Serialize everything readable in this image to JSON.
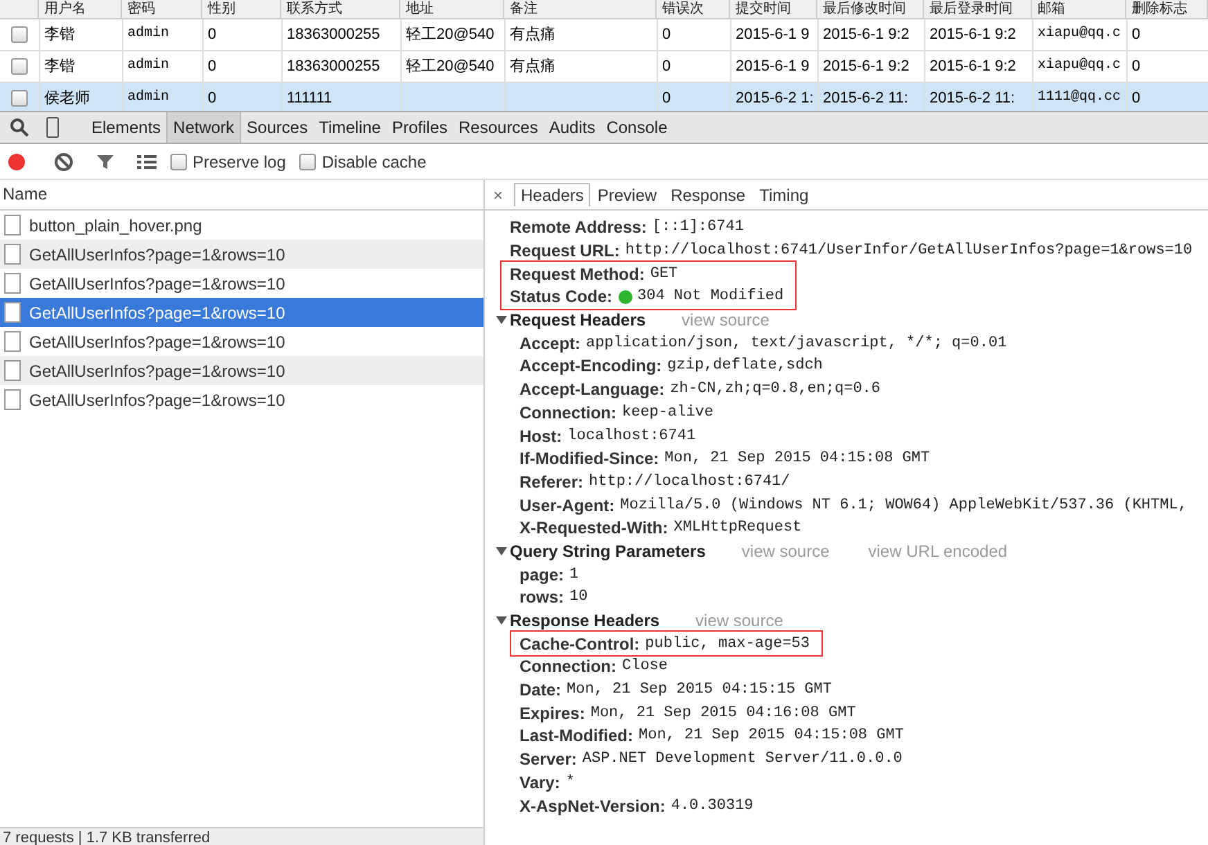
{
  "page_table": {
    "columns": [
      "用户名",
      "密码",
      "性别",
      "联系方式",
      "地址",
      "备注",
      "错误次",
      "提交时间",
      "最后修改时间",
      "最后登录时间",
      "邮箱",
      "删除标志"
    ],
    "rows": [
      {
        "checked": false,
        "selected": false,
        "cells": [
          "李锴",
          "admin",
          "0",
          "18363000255",
          "轻工20@540",
          "有点痛",
          "0",
          "2015-6-1 9",
          "2015-6-1 9:2",
          "2015-6-1 9:2",
          "xiapu@qq.c",
          "0"
        ]
      },
      {
        "checked": false,
        "selected": false,
        "cells": [
          "李锴",
          "admin",
          "0",
          "18363000255",
          "轻工20@540",
          "有点痛",
          "0",
          "2015-6-1 9",
          "2015-6-1 9:2",
          "2015-6-1 9:2",
          "xiapu@qq.c",
          "0"
        ]
      },
      {
        "checked": false,
        "selected": true,
        "cells": [
          "侯老师",
          "admin",
          "0",
          "111111",
          "",
          "",
          "0",
          "2015-6-2 1:",
          "2015-6-2 11:",
          "2015-6-2 11:",
          "1111@qq.cc",
          "0"
        ]
      }
    ]
  },
  "devtools": {
    "tabs": [
      {
        "label": "Elements",
        "selected": false
      },
      {
        "label": "Network",
        "selected": true
      },
      {
        "label": "Sources",
        "selected": false
      },
      {
        "label": "Timeline",
        "selected": false
      },
      {
        "label": "Profiles",
        "selected": false
      },
      {
        "label": "Resources",
        "selected": false
      },
      {
        "label": "Audits",
        "selected": false
      },
      {
        "label": "Console",
        "selected": false
      }
    ],
    "toolbar": {
      "recording": true,
      "checkboxes": [
        {
          "label": "Preserve log",
          "checked": false
        },
        {
          "label": "Disable cache",
          "checked": false
        }
      ]
    },
    "requests": {
      "column": "Name",
      "items": [
        {
          "name": "button_plain_hover.png",
          "selected": false
        },
        {
          "name": "GetAllUserInfos?page=1&rows=10",
          "selected": false
        },
        {
          "name": "GetAllUserInfos?page=1&rows=10",
          "selected": false
        },
        {
          "name": "GetAllUserInfos?page=1&rows=10",
          "selected": true
        },
        {
          "name": "GetAllUserInfos?page=1&rows=10",
          "selected": false
        },
        {
          "name": "GetAllUserInfos?page=1&rows=10",
          "selected": false
        },
        {
          "name": "GetAllUserInfos?page=1&rows=10",
          "selected": false
        }
      ]
    },
    "status_bar": "7 requests | 1.7 KB transferred",
    "detail": {
      "close": "×",
      "tabs": [
        {
          "label": "Headers",
          "selected": true
        },
        {
          "label": "Preview",
          "selected": false
        },
        {
          "label": "Response",
          "selected": false
        },
        {
          "label": "Timing",
          "selected": false
        }
      ],
      "general": [
        {
          "key": "Remote Address:",
          "value": "[::1]:6741",
          "highlighted": false,
          "kind": "text"
        },
        {
          "key": "Request URL:",
          "value": "http://localhost:6741/UserInfor/GetAllUserInfos?page=1&rows=10",
          "highlighted": false,
          "kind": "text"
        },
        {
          "key": "Request Method:",
          "value": "GET",
          "highlighted": true,
          "kind": "text"
        },
        {
          "key": "Status Code:",
          "value": "304 Not Modified",
          "highlighted": true,
          "kind": "status"
        }
      ],
      "sections": [
        {
          "title": "Request Headers",
          "expanded": true,
          "links": [
            "view source"
          ],
          "items": [
            {
              "key": "Accept:",
              "value": "application/json, text/javascript, */*; q=0.01",
              "highlighted": false
            },
            {
              "key": "Accept-Encoding:",
              "value": "gzip,deflate,sdch",
              "highlighted": false
            },
            {
              "key": "Accept-Language:",
              "value": "zh-CN,zh;q=0.8,en;q=0.6",
              "highlighted": false
            },
            {
              "key": "Connection:",
              "value": "keep-alive",
              "highlighted": false
            },
            {
              "key": "Host:",
              "value": "localhost:6741",
              "highlighted": false
            },
            {
              "key": "If-Modified-Since:",
              "value": "Mon, 21 Sep 2015 04:15:08 GMT",
              "highlighted": false
            },
            {
              "key": "Referer:",
              "value": "http://localhost:6741/",
              "highlighted": false
            },
            {
              "key": "User-Agent:",
              "value": "Mozilla/5.0 (Windows NT 6.1; WOW64) AppleWebKit/537.36 (KHTML,",
              "highlighted": false
            },
            {
              "key": "X-Requested-With:",
              "value": "XMLHttpRequest",
              "highlighted": false
            }
          ]
        },
        {
          "title": "Query String Parameters",
          "expanded": true,
          "links": [
            "view source",
            "view URL encoded"
          ],
          "items": [
            {
              "key": "page:",
              "value": "1",
              "highlighted": false
            },
            {
              "key": "rows:",
              "value": "10",
              "highlighted": false
            }
          ]
        },
        {
          "title": "Response Headers",
          "expanded": true,
          "links": [
            "view source"
          ],
          "items": [
            {
              "key": "Cache-Control:",
              "value": "public, max-age=53",
              "highlighted": true
            },
            {
              "key": "Connection:",
              "value": "Close",
              "highlighted": false
            },
            {
              "key": "Date:",
              "value": "Mon, 21 Sep 2015 04:15:15 GMT",
              "highlighted": false
            },
            {
              "key": "Expires:",
              "value": "Mon, 21 Sep 2015 04:16:08 GMT",
              "highlighted": false
            },
            {
              "key": "Last-Modified:",
              "value": "Mon, 21 Sep 2015 04:15:08 GMT",
              "highlighted": false
            },
            {
              "key": "Server:",
              "value": "ASP.NET Development Server/11.0.0.0",
              "highlighted": false
            },
            {
              "key": "Vary:",
              "value": "*",
              "highlighted": false
            },
            {
              "key": "X-AspNet-Version:",
              "value": "4.0.30319",
              "highlighted": false
            }
          ]
        }
      ]
    }
  }
}
